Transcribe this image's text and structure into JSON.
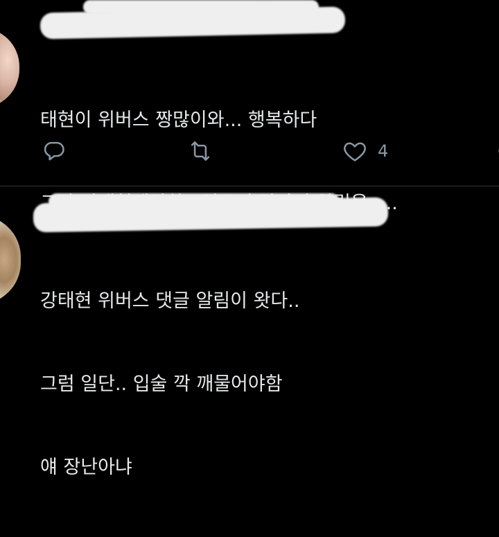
{
  "tweets": [
    {
      "lines": [
        "태현이 위버스 짱많이와... 행복하다",
        "그냥 강태현생각하고있으면 갑자기 알림옴....."
      ],
      "actions": {
        "reply_icon": "reply-icon",
        "retweet_icon": "retweet-icon",
        "like_icon": "heart-icon",
        "like_count": "4",
        "share_icon": "share-icon"
      }
    },
    {
      "lines": [
        "강태현 위버스 댓글 알림이 왓다..",
        "그럼 일단.. 입술 깍 깨물어야함",
        "얘 장난아냐"
      ]
    }
  ],
  "colors": {
    "background": "#000000",
    "text": "#e7e9ea",
    "secondary": "#8b98a5",
    "divider": "#2f3336"
  }
}
